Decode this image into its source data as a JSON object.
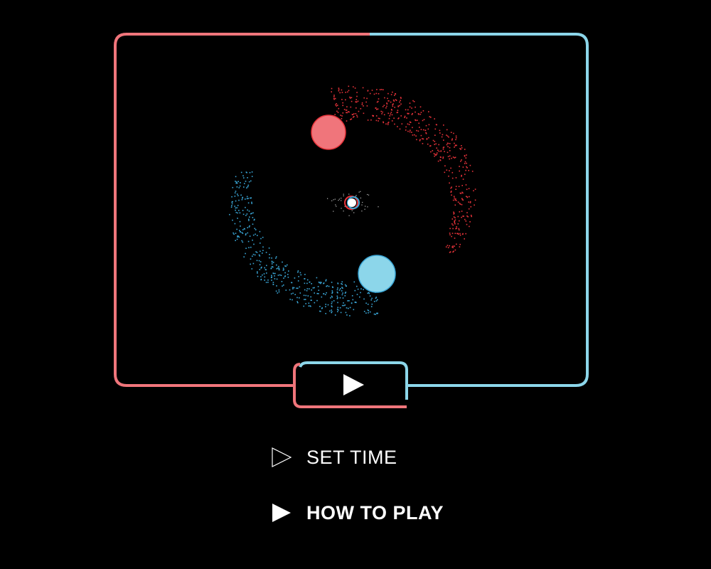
{
  "colors": {
    "red": "#f0757b",
    "red_particle": "#e8333a",
    "blue": "#8cd6ea",
    "blue_particle": "#3aa6d6",
    "background": "#000000",
    "text": "#ffffff"
  },
  "icons": {
    "play_button": "play-triangle-icon",
    "set_time_arrow": "outline-triangle-icon",
    "how_to_play_arrow": "filled-triangle-icon"
  },
  "menu": {
    "set_time_label": "SET TIME",
    "how_to_play_label": "HOW TO PLAY",
    "selected": "HOW TO PLAY"
  }
}
